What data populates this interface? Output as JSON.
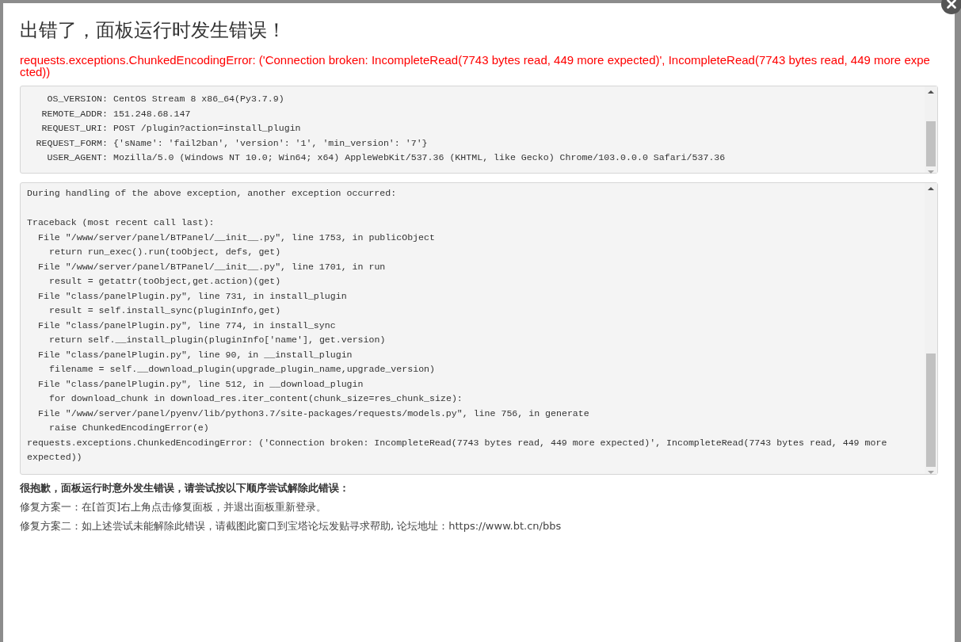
{
  "dialog": {
    "title": "出错了，面板运行时发生错误！",
    "error_message": "requests.exceptions.ChunkedEncodingError: ('Connection broken: IncompleteRead(7743 bytes read, 449 more expected)', IncompleteRead(7743 bytes read, 449 more expected))",
    "request_info": [
      {
        "key": "OS_VERSION:",
        "value": "CentOS Stream 8 x86_64(Py3.7.9)"
      },
      {
        "key": "REMOTE_ADDR:",
        "value": "151.248.68.147"
      },
      {
        "key": "REQUEST_URI:",
        "value": "POST /plugin?action=install_plugin"
      },
      {
        "key": "REQUEST_FORM:",
        "value": "{'sName': 'fail2ban', 'version': '1', 'min_version': '7'}"
      },
      {
        "key": "USER_AGENT:",
        "value": "Mozilla/5.0 (Windows NT 10.0; Win64; x64) AppleWebKit/537.36 (KHTML, like Gecko) Chrome/103.0.0.0 Safari/537.36"
      }
    ],
    "traceback": [
      {
        "kind": "text",
        "text": "During handling of the above exception, another exception occurred:"
      },
      {
        "kind": "blank"
      },
      {
        "kind": "text",
        "text": "Traceback (most recent call last):"
      },
      {
        "kind": "frame",
        "text": "File \"/www/server/panel/BTPanel/__init__.py\", line 1753, in publicObject"
      },
      {
        "kind": "source",
        "text": "return run_exec().run(toObject, defs, get)"
      },
      {
        "kind": "frame",
        "text": "File \"/www/server/panel/BTPanel/__init__.py\", line 1701, in run"
      },
      {
        "kind": "source",
        "text": "result = getattr(toObject,get.action)(get)"
      },
      {
        "kind": "frame",
        "text": "File \"class/panelPlugin.py\", line 731, in install_plugin"
      },
      {
        "kind": "source",
        "text": "result = self.install_sync(pluginInfo,get)"
      },
      {
        "kind": "frame",
        "text": "File \"class/panelPlugin.py\", line 774, in install_sync"
      },
      {
        "kind": "source",
        "text": "return self.__install_plugin(pluginInfo['name'], get.version)"
      },
      {
        "kind": "frame",
        "text": "File \"class/panelPlugin.py\", line 90, in __install_plugin"
      },
      {
        "kind": "source",
        "text": "filename = self.__download_plugin(upgrade_plugin_name,upgrade_version)"
      },
      {
        "kind": "frame",
        "text": "File \"class/panelPlugin.py\", line 512, in __download_plugin"
      },
      {
        "kind": "source",
        "text": "for download_chunk in download_res.iter_content(chunk_size=res_chunk_size):"
      },
      {
        "kind": "frame",
        "text": "File \"/www/server/panel/pyenv/lib/python3.7/site-packages/requests/models.py\", line 756, in generate"
      },
      {
        "kind": "source",
        "text": "raise ChunkedEncodingError(e)"
      },
      {
        "kind": "text",
        "text": "requests.exceptions.ChunkedEncodingError: ('Connection broken: IncompleteRead(7743 bytes read, 449 more expected)', IncompleteRead(7743 bytes read, 449 more expected))"
      }
    ],
    "help_heading": "很抱歉，面板运行时意外发生错误，请尝试按以下顺序尝试解除此错误：",
    "help_steps": [
      "修复方案一：在[首页]右上角点击修复面板，并退出面板重新登录。",
      "修复方案二：如上述尝试未能解除此错误，请截图此窗口到宝塔论坛发贴寻求帮助, 论坛地址：https://www.bt.cn/bbs"
    ]
  }
}
